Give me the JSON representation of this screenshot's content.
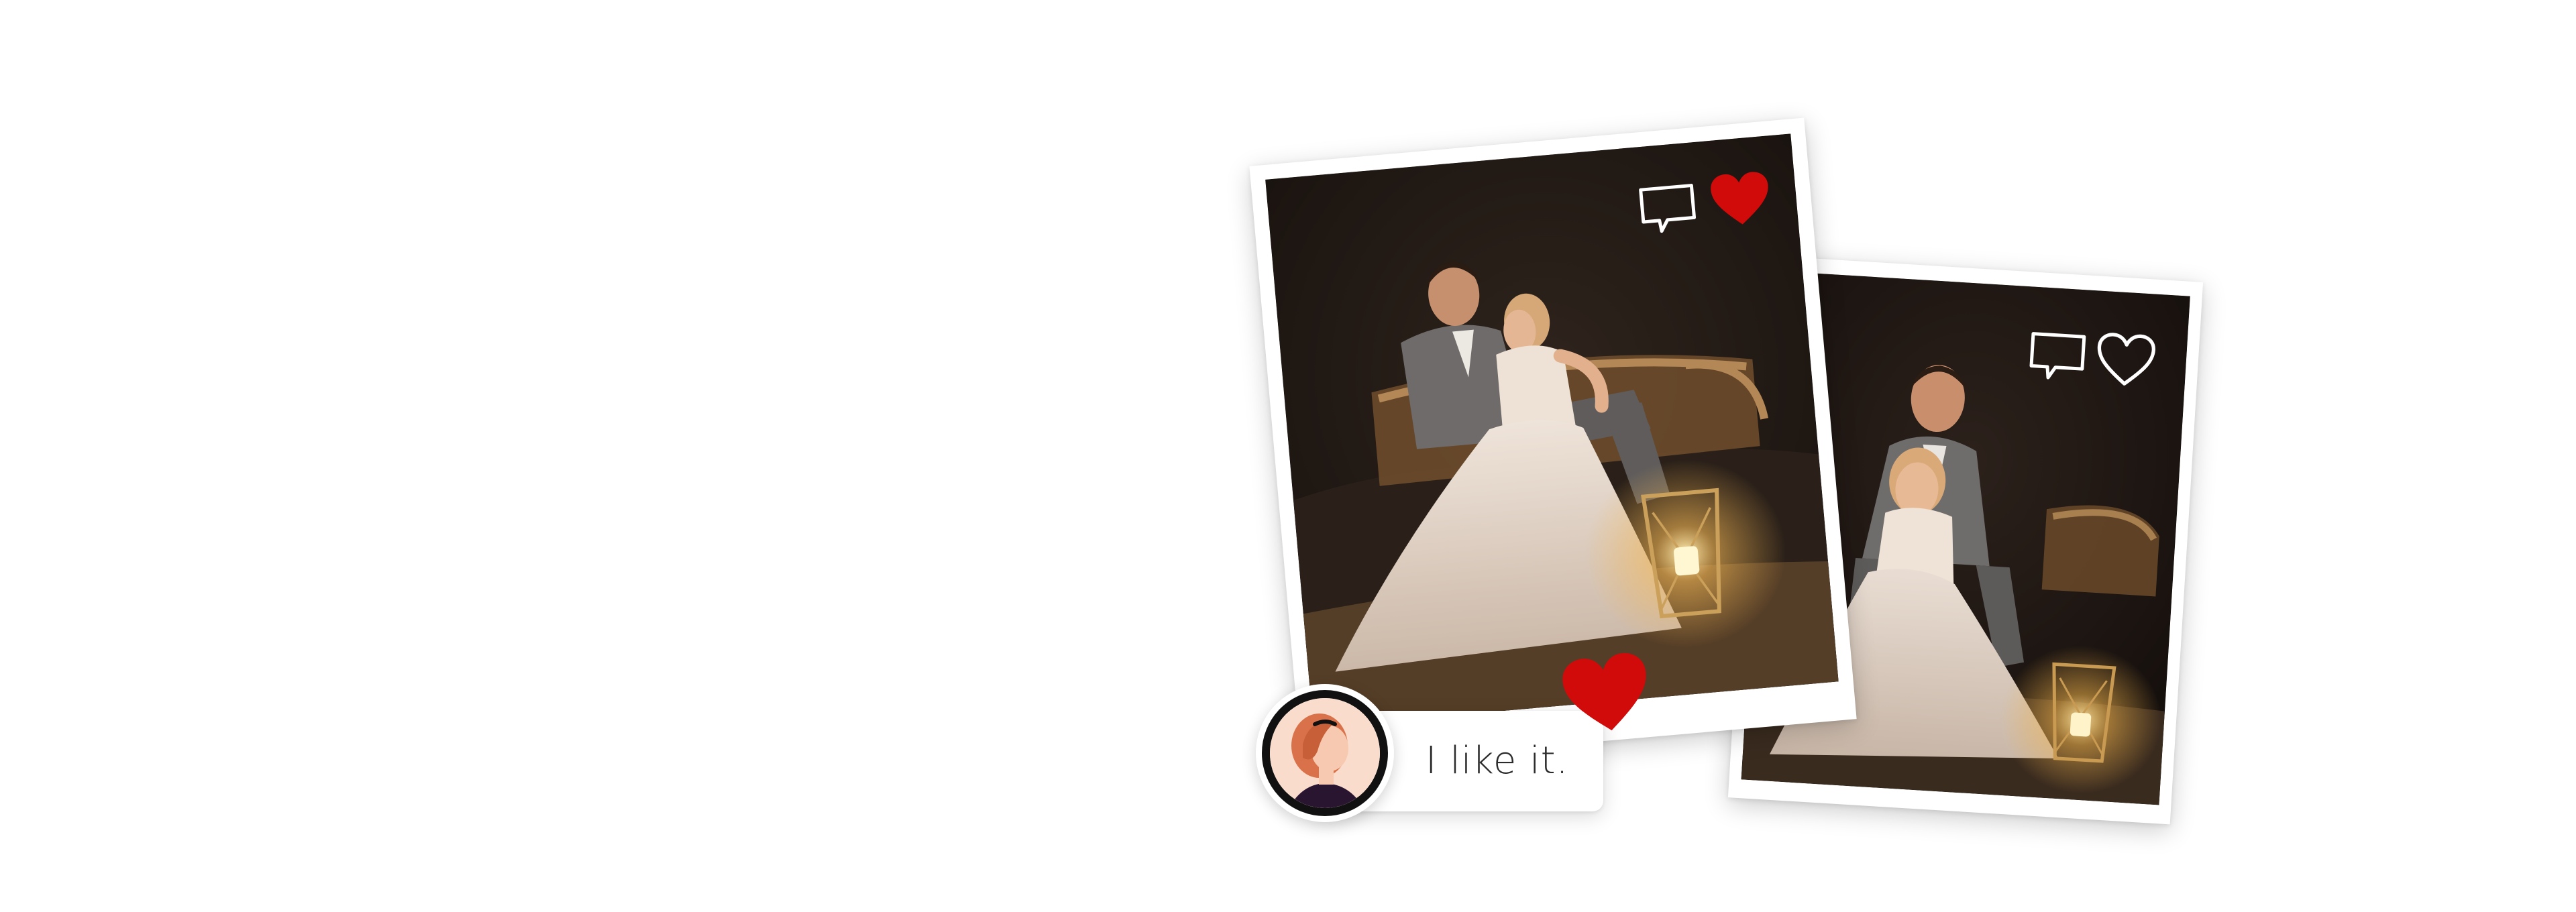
{
  "colors": {
    "background": "#ffffff",
    "heart_red": "#d10a0a",
    "icon_white": "#ffffff",
    "text_dark": "#2b2b2b",
    "avatar_ring": "#111111",
    "avatar_skin": "#f6c9b0",
    "avatar_hair": "#d9724a"
  },
  "posts": [
    {
      "photo": "couple-sitting-on-rattan-bench-with-lantern",
      "icons": [
        "comment-icon",
        "heart-filled-icon"
      ],
      "liked": true
    },
    {
      "photo": "couple-posing-bride-in-front-groom-behind",
      "icons": [
        "comment-icon",
        "heart-outline-icon"
      ],
      "liked": false
    }
  ],
  "comment": {
    "text": "I like it.",
    "avatar_icon": "user-avatar-icon",
    "reaction_icon": "heart-filled-icon"
  }
}
